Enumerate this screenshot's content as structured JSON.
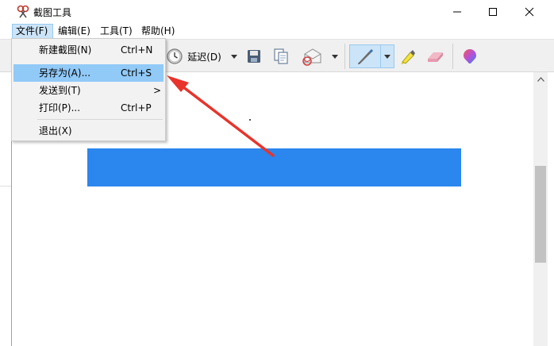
{
  "window": {
    "title": "截图工具"
  },
  "menubar": {
    "items": [
      {
        "label": "文件(F)"
      },
      {
        "label": "编辑(E)"
      },
      {
        "label": "工具(T)"
      },
      {
        "label": "帮助(H)"
      }
    ]
  },
  "toolbar": {
    "delay_label": "延迟(D)"
  },
  "file_menu": {
    "items": [
      {
        "label": "新建截图(N)",
        "shortcut": "Ctrl+N"
      },
      {
        "label": "另存为(A)...",
        "shortcut": "Ctrl+S",
        "highlighted": true
      },
      {
        "label": "发送到(T)",
        "submenu_arrow": ">"
      },
      {
        "label": "打印(P)...",
        "shortcut": "Ctrl+P"
      },
      {
        "label": "退出(X)"
      }
    ]
  },
  "colors": {
    "capture_rect": "#2b86ee",
    "highlight": "#91c9f7",
    "annotation_arrow": "#e8342c"
  },
  "icons": [
    "snipping-tool-icon",
    "minimize-icon",
    "maximize-icon",
    "close-icon",
    "clock-icon",
    "save-icon",
    "copy-icon",
    "send-email-icon",
    "pen-icon",
    "highlighter-icon",
    "eraser-icon",
    "paint3d-icon"
  ]
}
